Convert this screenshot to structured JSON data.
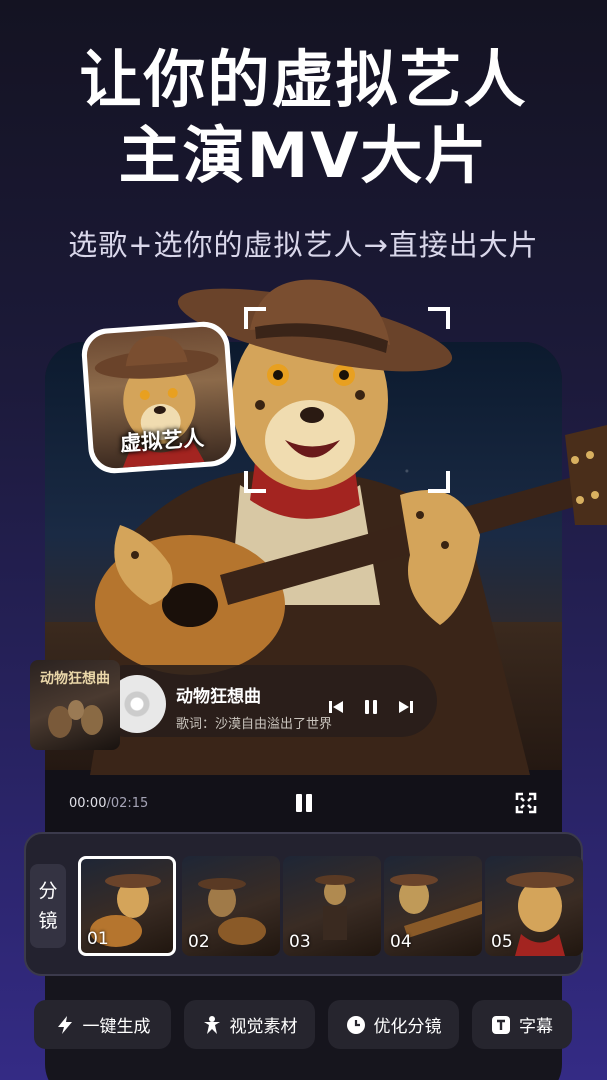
{
  "headline": {
    "line1": "让你的虚拟艺人",
    "line2": "主演MV大片"
  },
  "subheadline": "选歌+选你的虚拟艺人→直接出大片",
  "avatar": {
    "label": "虚拟艺人"
  },
  "song": {
    "cover_title": "动物狂想曲",
    "title": "动物狂想曲",
    "lyric": "歌词：沙漠自由溢出了世界",
    "prev_icon": "skip-previous-icon",
    "pause_icon": "pause-icon",
    "next_icon": "skip-next-icon"
  },
  "player": {
    "current_time": "00:00",
    "duration": "/02:15",
    "pause_icon": "pause-icon",
    "fullscreen_icon": "fullscreen-icon"
  },
  "storyboard": {
    "tab_label_1": "分",
    "tab_label_2": "镜",
    "frames": [
      {
        "num": "01",
        "selected": true
      },
      {
        "num": "02",
        "selected": false
      },
      {
        "num": "03",
        "selected": false
      },
      {
        "num": "04",
        "selected": false
      },
      {
        "num": "05",
        "selected": false
      }
    ]
  },
  "toolbar": {
    "tools": [
      {
        "label": "一键生成",
        "icon": "lightning-icon"
      },
      {
        "label": "视觉素材",
        "icon": "person-icon"
      },
      {
        "label": "优化分镜",
        "icon": "clock-icon"
      },
      {
        "label": "字幕",
        "icon": "text-icon"
      }
    ]
  },
  "colors": {
    "background_top": "#141322",
    "background_bottom": "#342b85",
    "panel": "#23222f",
    "button": "#26252e"
  }
}
